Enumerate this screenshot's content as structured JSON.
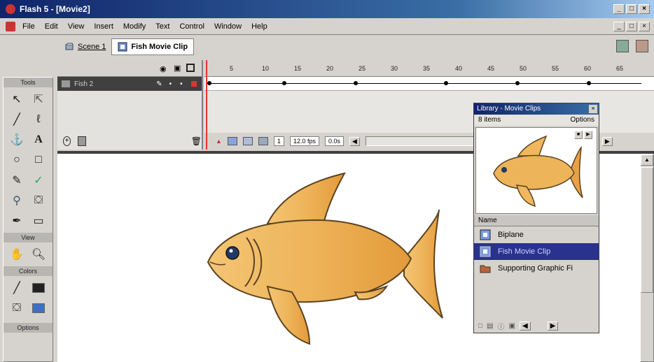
{
  "window": {
    "title": "Flash 5 - [Movie2]",
    "controls": [
      "_",
      "□",
      "×"
    ]
  },
  "menu": {
    "items": [
      "File",
      "Edit",
      "View",
      "Insert",
      "Modify",
      "Text",
      "Control",
      "Window",
      "Help"
    ]
  },
  "scene_bar": {
    "scene_label": "Scene 1",
    "symbol_label": "Fish Movie Clip"
  },
  "tools": {
    "section_tools": "Tools",
    "section_view": "View",
    "section_colors": "Colors",
    "section_options": "Options"
  },
  "timeline": {
    "layer_name": "Fish 2",
    "frame_ticks": [
      "5",
      "10",
      "15",
      "20",
      "25",
      "30",
      "35",
      "40",
      "45",
      "50",
      "55",
      "60",
      "65"
    ],
    "current_frame": "1",
    "frame_rate": "12.0 fps",
    "elapsed": "0.0s"
  },
  "library": {
    "title": "Library - Movie Clips",
    "item_count": "8 items",
    "options_label": "Options",
    "name_header": "Name",
    "items": [
      {
        "label": "Biplane",
        "icon": "movie-clip-icon"
      },
      {
        "label": "Fish Movie Clip",
        "icon": "movie-clip-icon"
      },
      {
        "label": "Supporting Graphic Fi",
        "icon": "folder-icon"
      }
    ]
  },
  "colors": {
    "fish_body": "#e8a347",
    "fish_light": "#f6cc78",
    "fish_outline": "#5a4321",
    "selection": "#29338e",
    "titlebar": "#10246a"
  }
}
